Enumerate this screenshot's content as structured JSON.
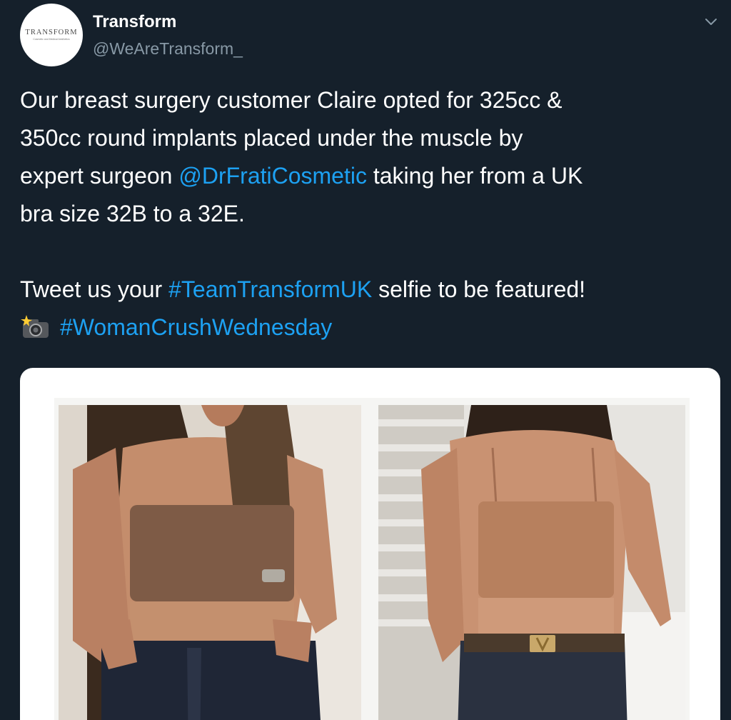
{
  "tweet": {
    "author": {
      "display_name": "Transform",
      "handle": "@WeAreTransform_",
      "avatar": {
        "brand": "TRANSFORM",
        "tagline": "Cosmetic and Medical Aesthetics"
      }
    },
    "menu_icon": "chevron-down-icon",
    "text": {
      "line1": "Our breast surgery customer Claire opted for 325cc &",
      "line2": "350cc round implants placed under the muscle by",
      "line3_before": "expert surgeon ",
      "mention": "@DrFratiCosmetic",
      "line3_after": " taking her from a UK",
      "line4": "bra size 32B to a 32E.",
      "line5_before": "Tweet us your ",
      "hashtag1": "#TeamTransformUK",
      "line5_after": " selfie to be featured!",
      "emoji": "camera-flash-icon",
      "hashtag2": "#WomanCrushWednesday"
    },
    "media": {
      "photos": [
        "before-photo",
        "after-photo"
      ]
    }
  },
  "colors": {
    "background": "#15202b",
    "text": "#ffffff",
    "secondary": "#8899a6",
    "link": "#1da1f2"
  }
}
